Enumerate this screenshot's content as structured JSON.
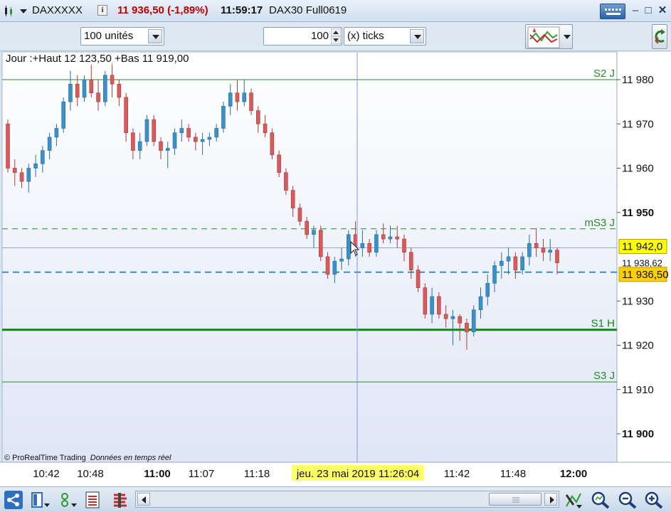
{
  "title_bar": {
    "instrument": "DAXXXXX",
    "info_icon": "info-icon",
    "price_change": "11 936,50 (-1,89%)",
    "time": "11:59:17",
    "market": "DAX30 Full0619"
  },
  "toolbar": {
    "units_select": "100 unités",
    "tick_count": "100",
    "tick_type_select": "(x) ticks"
  },
  "chart_data": {
    "type": "candlestick",
    "header_text": "Jour :+Haut 12 123,50 +Bas 11 919,00",
    "watermark": "© ProRealTime Trading",
    "watermark_note": "Données en temps réel",
    "y_ticks": [
      {
        "value": 11980,
        "label": "11 980",
        "bold": false
      },
      {
        "value": 11970,
        "label": "11 970",
        "bold": false
      },
      {
        "value": 11960,
        "label": "11 960",
        "bold": false
      },
      {
        "value": 11950,
        "label": "11 950",
        "bold": true
      },
      {
        "value": 11930,
        "label": "11 930",
        "bold": false
      },
      {
        "value": 11920,
        "label": "11 920",
        "bold": false
      },
      {
        "value": 11910,
        "label": "11 910",
        "bold": false
      },
      {
        "value": 11900,
        "label": "11 900",
        "bold": true
      }
    ],
    "ylim": [
      11894,
      11985
    ],
    "x_ticks": [
      {
        "label": "10:42",
        "bold": false
      },
      {
        "label": "10:48",
        "bold": false
      },
      {
        "label": "11:00",
        "bold": true
      },
      {
        "label": "11:07",
        "bold": false
      },
      {
        "label": "11:18",
        "bold": false
      },
      {
        "label": "11:42",
        "bold": false
      },
      {
        "label": "11:48",
        "bold": false
      },
      {
        "label": "12:00",
        "bold": true
      }
    ],
    "cursor_date_label": "jeu. 23 mai 2019 11:26:04",
    "levels": [
      {
        "label": "S2 J",
        "value": 11980.0,
        "style": "solid-thin",
        "color": "#2a8a2a"
      },
      {
        "label": "mS3 J",
        "value": 11946.3,
        "style": "dashed-green",
        "color": "#2a8a2a"
      },
      {
        "label": "S1 H",
        "value": 11923.5,
        "style": "solid-thick",
        "color": "#0d8a0d"
      },
      {
        "label": "S3 J",
        "value": 11911.7,
        "style": "solid-thin",
        "color": "#2a8a2a"
      }
    ],
    "price_badges": [
      {
        "label": "11 942,0",
        "value": 11942.0,
        "bg": "#ffff00"
      },
      {
        "label": "11 938,62",
        "value": 11938.62,
        "bg": "#ffffff"
      },
      {
        "label": "11 936,50",
        "value": 11936.5,
        "bg": "#ffd000"
      }
    ],
    "current_price_line": 11936.5,
    "cursor_price_line": 11942.0,
    "candles": [
      [
        11970.0,
        11971.0,
        11959.0,
        11960.0
      ],
      [
        11960.0,
        11962.0,
        11956.0,
        11959.0
      ],
      [
        11959.0,
        11960.0,
        11955.5,
        11957.0
      ],
      [
        11957.0,
        11961.0,
        11954.5,
        11960.0
      ],
      [
        11960.0,
        11963.0,
        11958.0,
        11961.0
      ],
      [
        11961.0,
        11965.0,
        11959.0,
        11964.0
      ],
      [
        11964.0,
        11968.0,
        11962.0,
        11967.0
      ],
      [
        11967.0,
        11970.0,
        11965.0,
        11969.0
      ],
      [
        11969.0,
        11976.0,
        11968.0,
        11975.0
      ],
      [
        11975.0,
        11982.0,
        11973.0,
        11979.0
      ],
      [
        11979.0,
        11981.0,
        11974.0,
        11976.0
      ],
      [
        11976.0,
        11981.0,
        11975.0,
        11980.0
      ],
      [
        11980.0,
        11983.5,
        11976.0,
        11977.0
      ],
      [
        11977.0,
        11980.0,
        11973.0,
        11975.0
      ],
      [
        11975.0,
        11982.0,
        11974.0,
        11981.0
      ],
      [
        11981.0,
        11984.0,
        11976.0,
        11979.0
      ],
      [
        11979.0,
        11980.0,
        11974.0,
        11976.0
      ],
      [
        11976.0,
        11977.0,
        11966.0,
        11968.0
      ],
      [
        11968.0,
        11969.0,
        11962.0,
        11964.0
      ],
      [
        11964.0,
        11968.0,
        11962.0,
        11966.0
      ],
      [
        11966.0,
        11972.0,
        11965.0,
        11971.0
      ],
      [
        11971.0,
        11972.0,
        11965.0,
        11966.0
      ],
      [
        11966.0,
        11967.0,
        11962.0,
        11964.0
      ],
      [
        11964.0,
        11966.0,
        11960.0,
        11964.5
      ],
      [
        11964.5,
        11969.0,
        11963.0,
        11968.0
      ],
      [
        11968.0,
        11971.0,
        11966.0,
        11969.0
      ],
      [
        11969.0,
        11970.0,
        11966.0,
        11967.0
      ],
      [
        11967.0,
        11968.0,
        11964.0,
        11966.0
      ],
      [
        11966.0,
        11968.0,
        11963.0,
        11966.5
      ],
      [
        11966.5,
        11968.0,
        11965.0,
        11967.0
      ],
      [
        11967.0,
        11970.0,
        11966.0,
        11969.0
      ],
      [
        11969.0,
        11975.0,
        11968.0,
        11974.0
      ],
      [
        11974.0,
        11979.0,
        11972.0,
        11977.0
      ],
      [
        11977.0,
        11980.0,
        11973.0,
        11975.0
      ],
      [
        11975.0,
        11980.0,
        11974.0,
        11977.0
      ],
      [
        11977.0,
        11978.0,
        11972.0,
        11973.0
      ],
      [
        11973.0,
        11974.0,
        11968.0,
        11970.0
      ],
      [
        11970.0,
        11972.0,
        11967.0,
        11968.0
      ],
      [
        11968.0,
        11969.0,
        11962.0,
        11963.0
      ],
      [
        11963.0,
        11964.0,
        11958.0,
        11959.0
      ],
      [
        11959.0,
        11960.0,
        11954.0,
        11955.0
      ],
      [
        11955.0,
        11956.0,
        11949.0,
        11951.0
      ],
      [
        11951.0,
        11952.0,
        11947.0,
        11948.0
      ],
      [
        11948.0,
        11949.0,
        11944.0,
        11945.0
      ],
      [
        11945.0,
        11947.0,
        11942.0,
        11946.0
      ],
      [
        11946.0,
        11947.0,
        11939.0,
        11940.0
      ],
      [
        11940.0,
        11941.0,
        11935.0,
        11936.0
      ],
      [
        11936.0,
        11940.0,
        11934.0,
        11939.0
      ],
      [
        11939.0,
        11942.0,
        11937.0,
        11939.5
      ],
      [
        11939.5,
        11946.0,
        11938.0,
        11945.0
      ],
      [
        11945.0,
        11948.0,
        11940.0,
        11942.0
      ],
      [
        11942.0,
        11946.0,
        11940.0,
        11943.0
      ],
      [
        11943.0,
        11944.0,
        11940.0,
        11941.0
      ],
      [
        11941.0,
        11946.0,
        11940.0,
        11945.0
      ],
      [
        11945.0,
        11947.5,
        11943.0,
        11944.0
      ],
      [
        11944.0,
        11947.0,
        11943.0,
        11944.5
      ],
      [
        11944.5,
        11947.0,
        11942.0,
        11944.0
      ],
      [
        11944.0,
        11945.0,
        11939.0,
        11941.0
      ],
      [
        11941.0,
        11942.0,
        11935.0,
        11937.0
      ],
      [
        11937.0,
        11938.0,
        11932.0,
        11933.0
      ],
      [
        11933.0,
        11934.0,
        11926.0,
        11927.0
      ],
      [
        11927.0,
        11933.0,
        11925.0,
        11931.0
      ],
      [
        11931.0,
        11932.0,
        11926.0,
        11927.0
      ],
      [
        11927.0,
        11929.0,
        11924.0,
        11926.0
      ],
      [
        11926.0,
        11928.0,
        11920.0,
        11926.5
      ],
      [
        11926.5,
        11927.0,
        11921.0,
        11925.0
      ],
      [
        11925.0,
        11926.0,
        11919.0,
        11923.0
      ],
      [
        11923.0,
        11929.0,
        11922.0,
        11928.0
      ],
      [
        11928.0,
        11933.0,
        11926.0,
        11931.0
      ],
      [
        11931.0,
        11936.0,
        11929.0,
        11934.0
      ],
      [
        11934.0,
        11939.0,
        11932.0,
        11938.0
      ],
      [
        11938.0,
        11941.0,
        11935.0,
        11939.0
      ],
      [
        11939.0,
        11942.0,
        11936.0,
        11940.0
      ],
      [
        11940.0,
        11941.0,
        11935.0,
        11937.0
      ],
      [
        11937.0,
        11941.0,
        11936.0,
        11940.0
      ],
      [
        11940.0,
        11945.0,
        11938.0,
        11943.0
      ],
      [
        11943.0,
        11946.5,
        11940.0,
        11942.0
      ],
      [
        11942.0,
        11944.0,
        11939.0,
        11941.0
      ],
      [
        11941.0,
        11944.0,
        11939.0,
        11941.5
      ],
      [
        11941.5,
        11942.0,
        11936.0,
        11938.6
      ]
    ]
  },
  "bottom_bar": {
    "icons": [
      "share-icon",
      "layout-icon",
      "drawing-tools-icon",
      "indicators-icon",
      "trading-icon"
    ],
    "zoom_icons": [
      "auto-zoom-icon",
      "zoom-out-icon",
      "zoom-in-icon"
    ]
  }
}
